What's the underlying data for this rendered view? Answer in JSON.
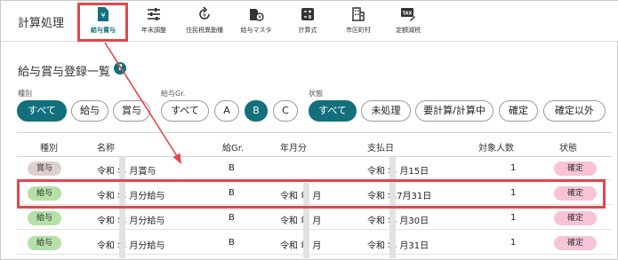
{
  "app": {
    "title": "計算処理"
  },
  "nav": [
    {
      "id": "bonus",
      "label": "給与賞与",
      "icon": "yen-document-icon",
      "active": true
    },
    {
      "id": "year-end",
      "label": "年末調整",
      "icon": "sliders-icon",
      "active": false
    },
    {
      "id": "resident-tax",
      "label": "住民税異動播",
      "icon": "rotate-yen-icon",
      "active": false
    },
    {
      "id": "salary-master",
      "label": "給与マスタ",
      "icon": "yen-folder-icon",
      "active": false
    },
    {
      "id": "formula",
      "label": "計算式",
      "icon": "calculator-icon",
      "active": false
    },
    {
      "id": "city",
      "label": "市区町村",
      "icon": "building-icon",
      "active": false
    },
    {
      "id": "flat-tax",
      "label": "定額減税",
      "icon": "tax-icon",
      "active": false
    }
  ],
  "section": {
    "title": "給与賞与登録一覧",
    "help": "?"
  },
  "filters": {
    "type": {
      "label": "種別",
      "chips": [
        "すべて",
        "給与",
        "賞与"
      ]
    },
    "group": {
      "label": "給与Gr.",
      "chips": [
        "すべて",
        "A",
        "B",
        "C"
      ]
    },
    "status": {
      "label": "状態",
      "chips": [
        "すべて",
        "未処理",
        "要計算/計算中",
        "確定",
        "確定以外"
      ]
    }
  },
  "table": {
    "headers": [
      "種別",
      "名称",
      "給Gr.",
      "年月分",
      "支払日",
      "対象人数",
      "状態"
    ],
    "rows": [
      {
        "type": "賞与",
        "name": "令和 年 月賞与",
        "group": "B",
        "period": "",
        "pay_date": "令和 年 月15日",
        "count": "1",
        "status": "確定"
      },
      {
        "type": "給与",
        "name": "令和 年 月分給与",
        "group": "B",
        "period": "令和 年 月",
        "pay_date": "令和 年7月31日",
        "count": "1",
        "status": "確定"
      },
      {
        "type": "給与",
        "name": "令和 年 月分給与",
        "group": "B",
        "period": "令和 年 月",
        "pay_date": "令和 年 月30日",
        "count": "1",
        "status": "確定"
      },
      {
        "type": "給与",
        "name": "令和 年 月分給与",
        "group": "B",
        "period": "令和 年 月",
        "pay_date": "令和 年 月31日",
        "count": "1",
        "status": "確定"
      }
    ]
  },
  "colors": {
    "accent": "#12707c",
    "highlight": "#e0474c",
    "bonus_badge": "#ddd0cf",
    "salary_badge": "#b5e0a6",
    "status_badge": "#f7c3d6"
  }
}
